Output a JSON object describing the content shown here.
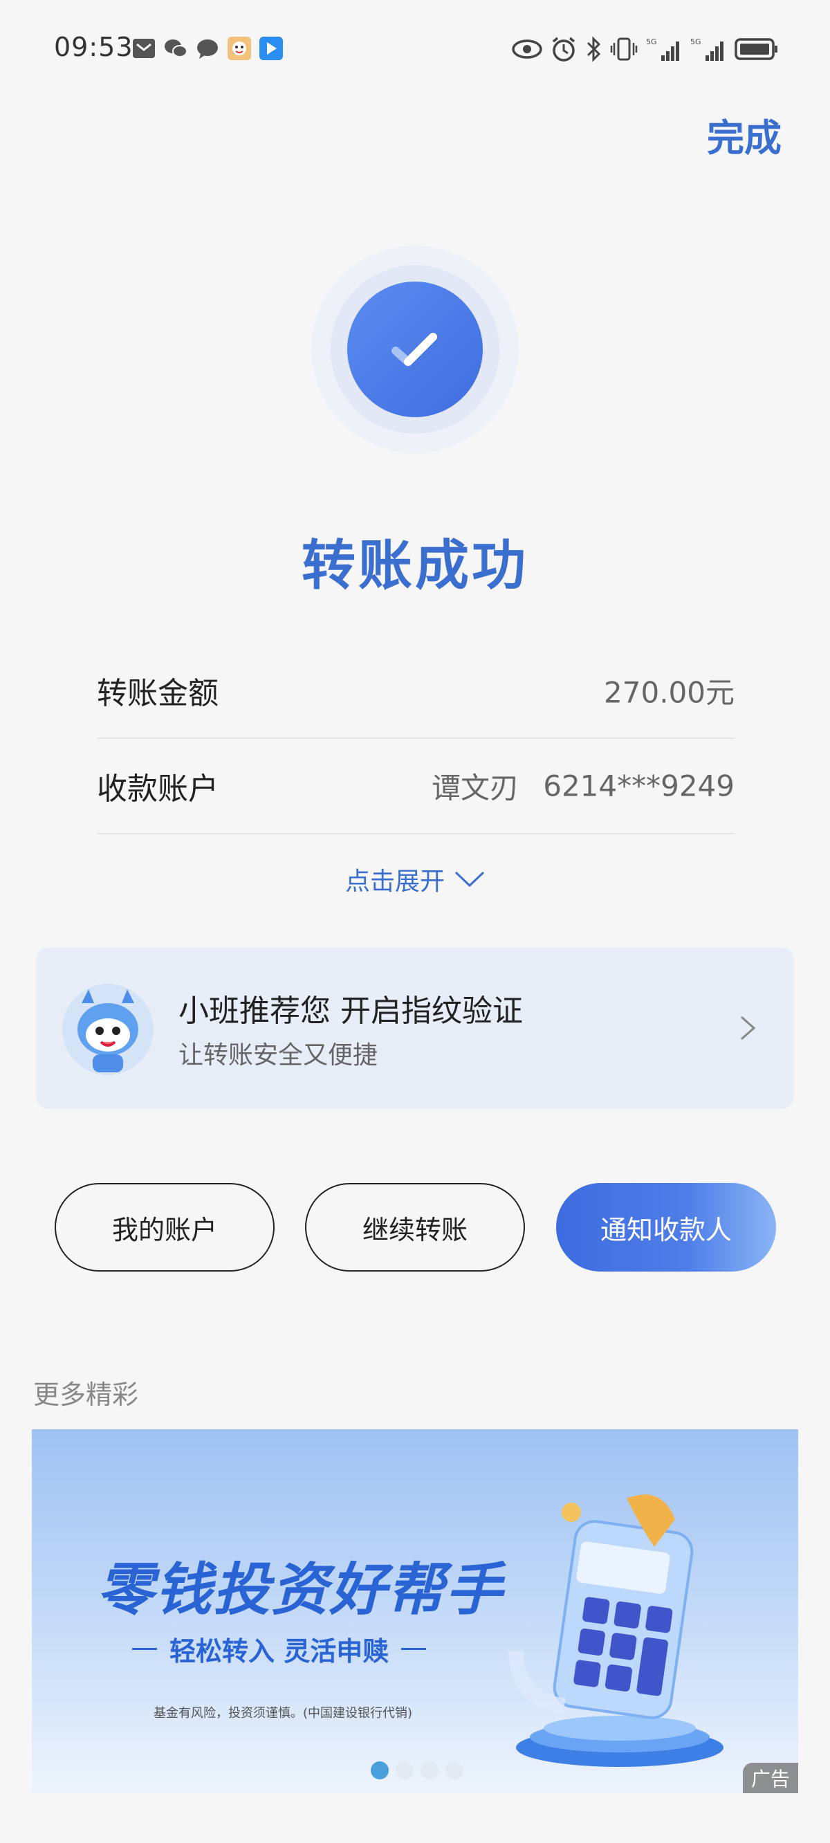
{
  "status_bar": {
    "time": "09:53",
    "signal_label_1": "5G",
    "signal_label_2": "5G"
  },
  "header": {
    "done_label": "完成"
  },
  "result": {
    "title": "转账成功"
  },
  "details": {
    "amount_label": "转账金额",
    "amount_value": "270.00元",
    "account_label": "收款账户",
    "account_name": "谭文刃",
    "account_number": "6214***9249",
    "expand_label": "点击展开"
  },
  "recommend": {
    "title": "小班推荐您 开启指纹验证",
    "subtitle": "让转账安全又便捷"
  },
  "actions": {
    "my_account": "我的账户",
    "continue_transfer": "继续转账",
    "notify_payee": "通知收款人"
  },
  "more": {
    "section_title": "更多精彩",
    "banner_title": "零钱投资好帮手",
    "banner_subtitle": "轻松转入 灵活申赎",
    "banner_note": "基金有风险，投资须谨慎。(中国建设银行代销)",
    "ad_label": "广告",
    "carousel_pages": 4,
    "carousel_active": 1
  },
  "colors": {
    "accent": "#3a6fd0",
    "background": "#f6f6f6"
  }
}
